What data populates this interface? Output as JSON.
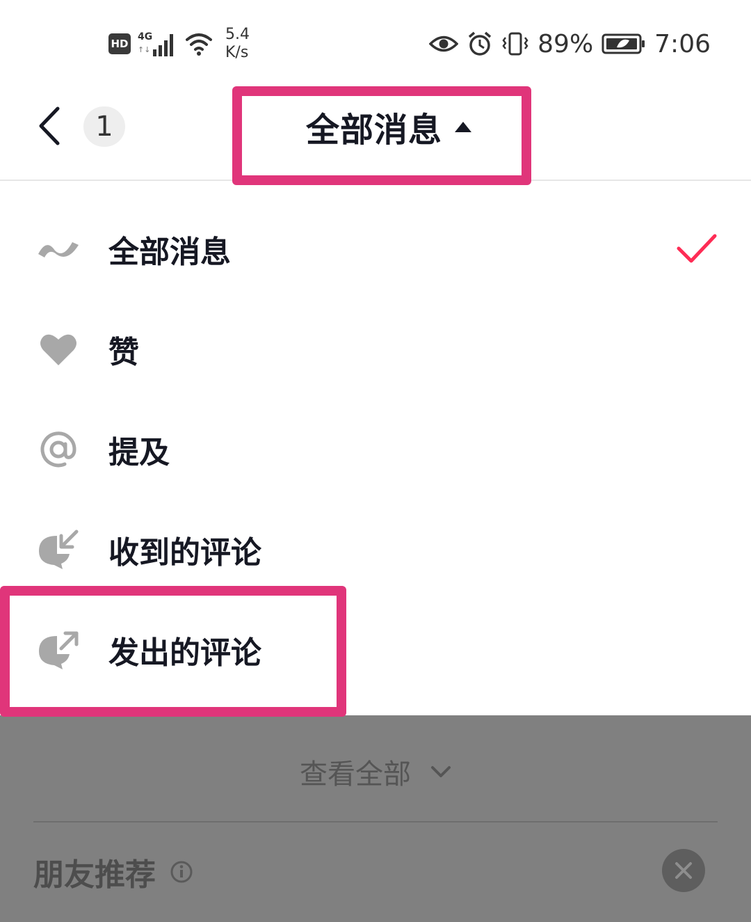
{
  "status_bar": {
    "hd": "HD",
    "net_type": "4G",
    "speed_value": "5.4",
    "speed_unit": "K/s",
    "battery": "89%",
    "time": "7:06"
  },
  "header": {
    "unread_count": "1",
    "title": "全部消息"
  },
  "menu": {
    "items": [
      {
        "label": "全部消息",
        "icon": "wave-icon",
        "selected": true
      },
      {
        "label": "赞",
        "icon": "heart-icon",
        "selected": false
      },
      {
        "label": "提及",
        "icon": "at-icon",
        "selected": false
      },
      {
        "label": "收到的评论",
        "icon": "comment-received-icon",
        "selected": false
      },
      {
        "label": "发出的评论",
        "icon": "comment-sent-icon",
        "selected": false
      }
    ]
  },
  "background": {
    "view_all": "查看全部",
    "friends_title": "朋友推荐"
  },
  "colors": {
    "accent": "#fe2c55",
    "highlight": "#e0357a",
    "icon_gray": "#a8a8a8",
    "dim": "#808080"
  }
}
